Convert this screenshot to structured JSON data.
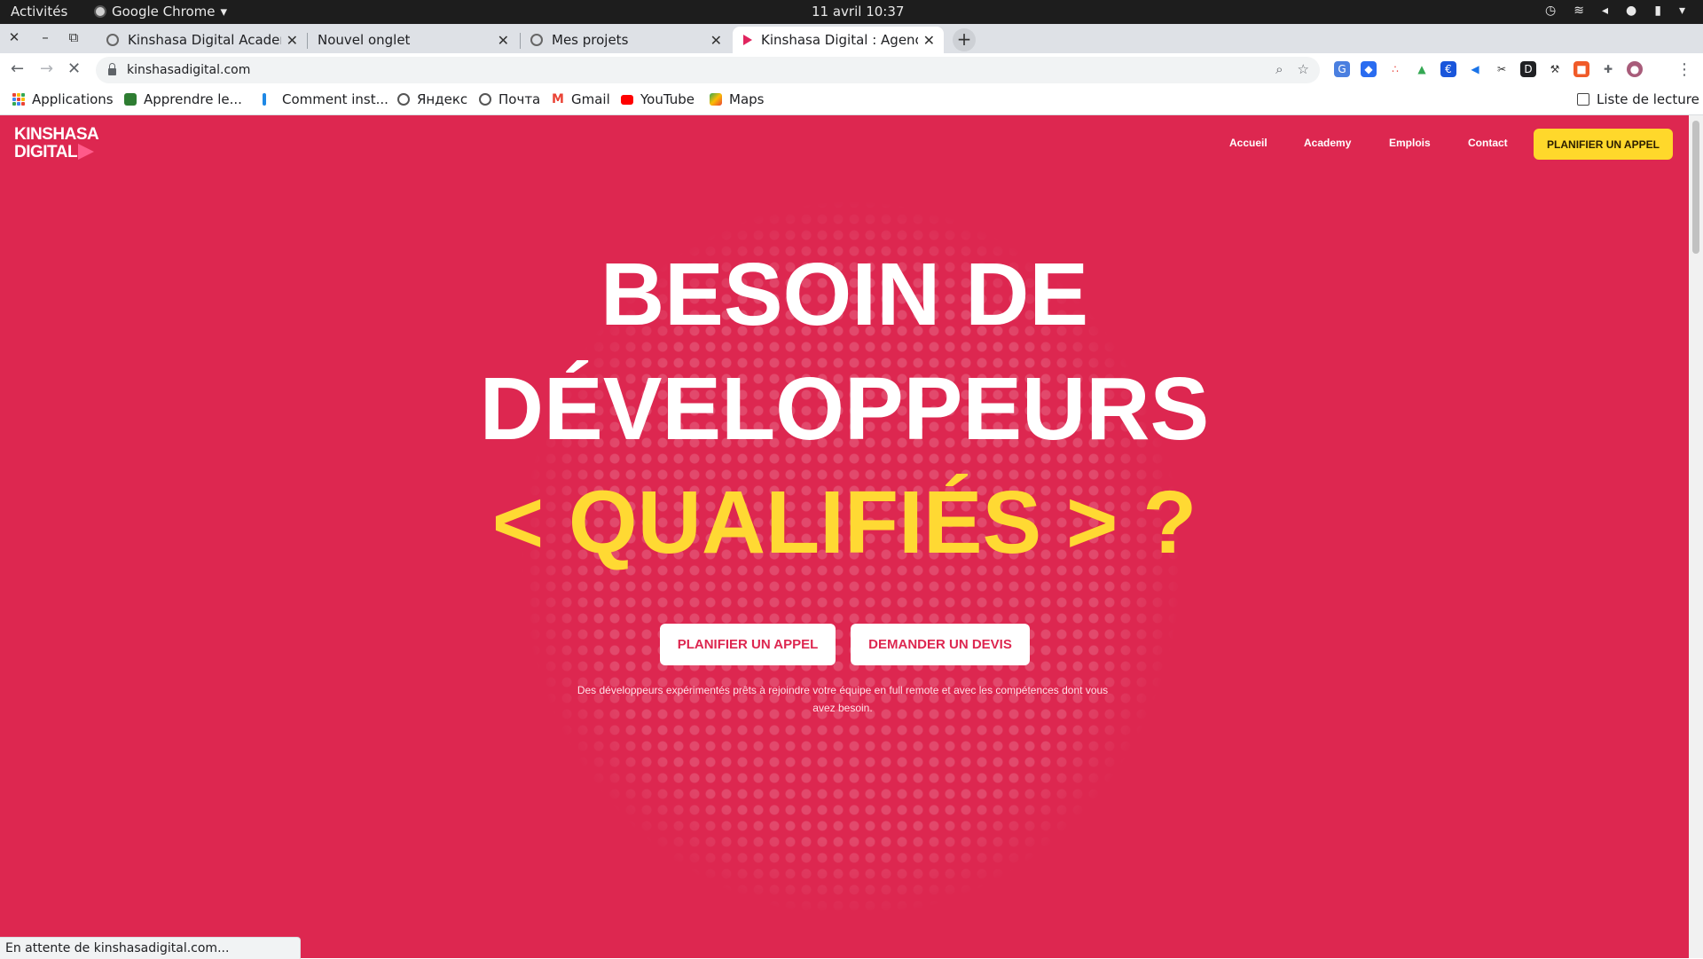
{
  "os": {
    "activities": "Activités",
    "app_name": "Google Chrome",
    "clock": "11 avril  10:37"
  },
  "tabs": [
    {
      "title": "Kinshasa Digital Academy",
      "active": false
    },
    {
      "title": "Nouvel onglet",
      "active": false
    },
    {
      "title": "Mes projets",
      "active": false
    },
    {
      "title": "Kinshasa Digital : Agence",
      "active": true
    }
  ],
  "toolbar": {
    "url": "kinshasadigital.com"
  },
  "bookmarks": {
    "apps": "Applications",
    "items": [
      "Apprendre le...",
      "Comment inst...",
      "Яндекс",
      "Почта",
      "Gmail",
      "YouTube",
      "Maps"
    ],
    "reading_list": "Liste de lecture"
  },
  "site": {
    "logo_line1": "KINSHASA",
    "logo_line2": "DIGITAL",
    "nav": [
      "Accueil",
      "Academy",
      "Emplois",
      "Contact"
    ],
    "cta_top": "PLANIFIER UN APPEL",
    "hero_line1": "BESOIN DE",
    "hero_line2": "DÉVELOPPEURS",
    "hero_line3": "< QUALIFIÉS > ?",
    "btn_call": "PLANIFIER UN APPEL",
    "btn_quote": "DEMANDER UN DEVIS",
    "subtitle": "Des développeurs expérimentés prêts à rejoindre votre équipe en full remote et avec les compétences dont vous avez besoin."
  },
  "status": "En attente de kinshasadigital.com...",
  "colors": {
    "brand_red": "#dd2750",
    "accent_yellow": "#ffd82b"
  }
}
